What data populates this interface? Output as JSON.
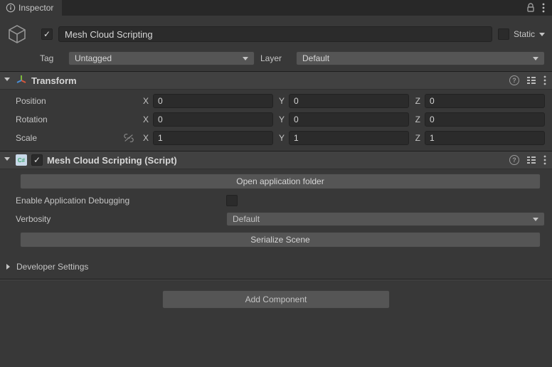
{
  "tabBar": {
    "title": "Inspector"
  },
  "header": {
    "name": "Mesh Cloud Scripting",
    "staticLabel": "Static",
    "tagLabel": "Tag",
    "tagValue": "Untagged",
    "layerLabel": "Layer",
    "layerValue": "Default"
  },
  "transform": {
    "title": "Transform",
    "rows": [
      {
        "label": "Position",
        "x": "0",
        "y": "0",
        "z": "0"
      },
      {
        "label": "Rotation",
        "x": "0",
        "y": "0",
        "z": "0"
      },
      {
        "label": "Scale",
        "x": "1",
        "y": "1",
        "z": "1"
      }
    ],
    "axis": {
      "x": "X",
      "y": "Y",
      "z": "Z"
    }
  },
  "script": {
    "title": "Mesh Cloud Scripting (Script)",
    "openFolderBtn": "Open application folder",
    "enableDebugLabel": "Enable Application Debugging",
    "verbosityLabel": "Verbosity",
    "verbosityValue": "Default",
    "serializeBtn": "Serialize Scene"
  },
  "devSettings": "Developer Settings",
  "addComponent": "Add Component"
}
